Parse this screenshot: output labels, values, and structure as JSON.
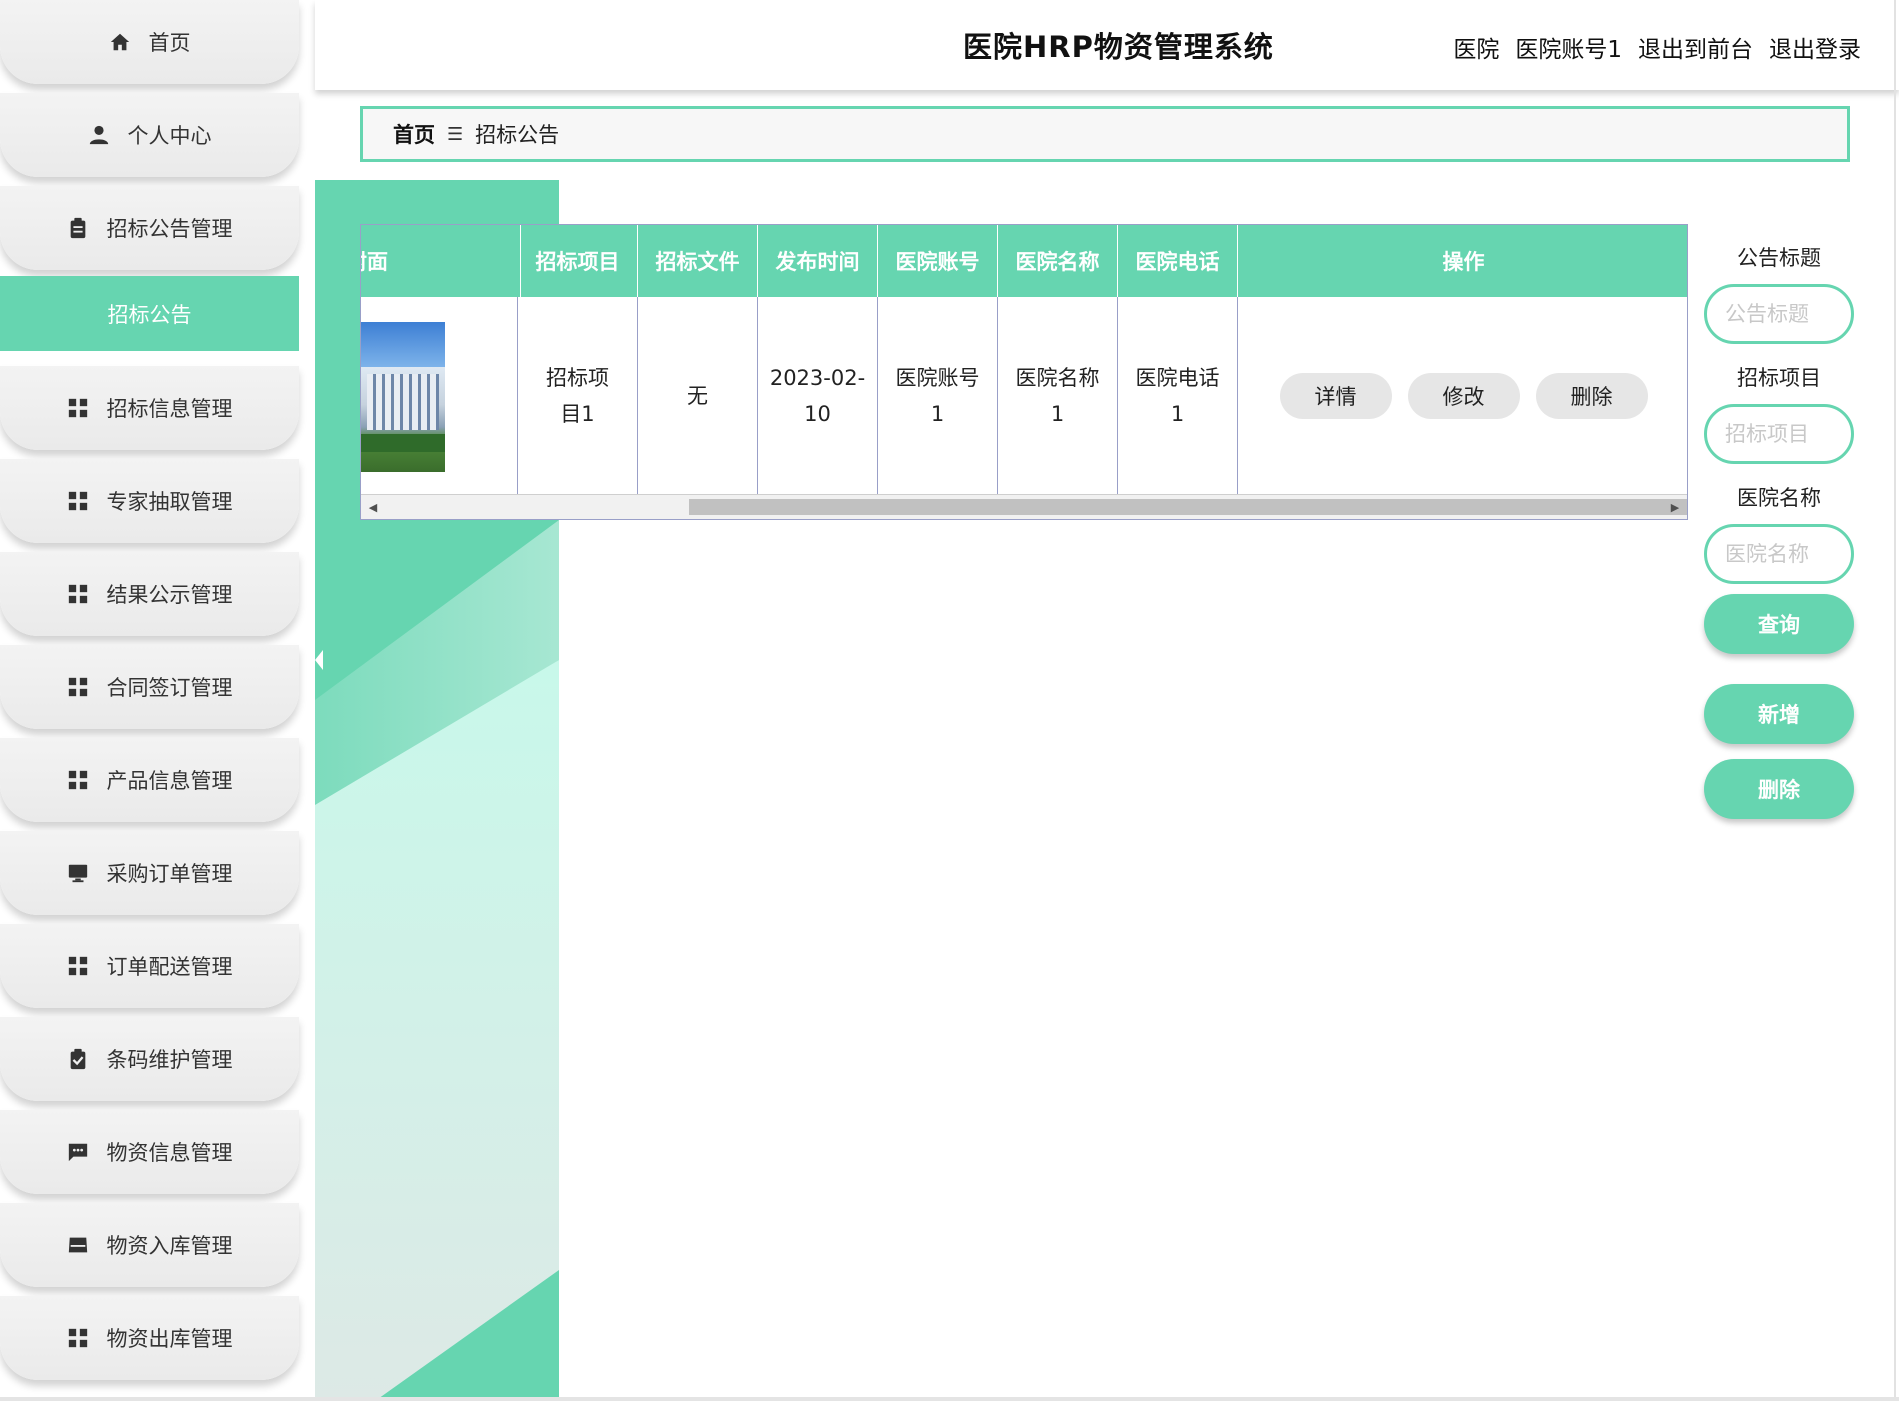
{
  "app": {
    "title": "医院HRP物资管理系统"
  },
  "header": {
    "role": "医院",
    "account": "医院账号1",
    "back_to_front": "退出到前台",
    "logout": "退出登录"
  },
  "sidebar": {
    "items": [
      {
        "label": "首页",
        "icon": "home-icon"
      },
      {
        "label": "个人中心",
        "icon": "person-icon"
      },
      {
        "label": "招标公告管理",
        "icon": "clipboard-icon"
      },
      {
        "label": "招标公告",
        "icon": ""
      },
      {
        "label": "招标信息管理",
        "icon": "grid-icon"
      },
      {
        "label": "专家抽取管理",
        "icon": "grid-icon"
      },
      {
        "label": "结果公示管理",
        "icon": "grid-icon"
      },
      {
        "label": "合同签订管理",
        "icon": "grid-icon"
      },
      {
        "label": "产品信息管理",
        "icon": "grid-icon"
      },
      {
        "label": "采购订单管理",
        "icon": "monitor-icon"
      },
      {
        "label": "订单配送管理",
        "icon": "grid-icon"
      },
      {
        "label": "条码维护管理",
        "icon": "clipboard-check-icon"
      },
      {
        "label": "物资信息管理",
        "icon": "chat-icon"
      },
      {
        "label": "物资入库管理",
        "icon": "inbox-icon"
      },
      {
        "label": "物资出库管理",
        "icon": "grid-icon"
      }
    ]
  },
  "breadcrumb": {
    "home": "首页",
    "current": "招标公告"
  },
  "table": {
    "headers": [
      "封面",
      "招标项目",
      "招标文件",
      "发布时间",
      "医院账号",
      "医院名称",
      "医院电话",
      "操作"
    ],
    "rows": [
      {
        "project": "招标项目1",
        "file": "无",
        "time": "2023-02-10",
        "account": "医院账号1",
        "name": "医院名称1",
        "phone": "医院电话1"
      }
    ],
    "actions": {
      "detail": "详情",
      "edit": "修改",
      "delete": "删除"
    }
  },
  "search": {
    "title_label": "公告标题",
    "title_placeholder": "公告标题",
    "project_label": "招标项目",
    "project_placeholder": "招标项目",
    "hospital_label": "医院名称",
    "hospital_placeholder": "医院名称",
    "query": "查询",
    "add": "新增",
    "delete": "删除"
  },
  "colors": {
    "accent": "#66d5b0",
    "accent_light": "#c8f5e5",
    "nav_bg": "#eeeeee"
  }
}
